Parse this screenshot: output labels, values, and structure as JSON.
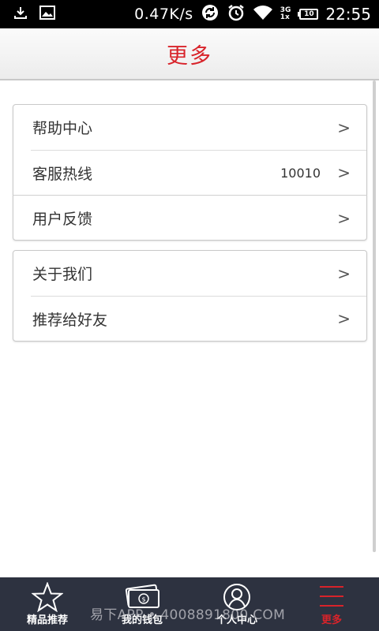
{
  "status_bar": {
    "speed": "0.47K/s",
    "network_top": "3G",
    "network_bottom": "1x",
    "battery": "10",
    "time": "22:55"
  },
  "header": {
    "title": "更多"
  },
  "menu_groups": [
    {
      "items": [
        {
          "label": "帮助中心",
          "value": "",
          "chevron": ">"
        },
        {
          "label": "客服热线",
          "value": "10010",
          "chevron": ">"
        },
        {
          "label": "用户反馈",
          "value": "",
          "chevron": ">"
        }
      ]
    },
    {
      "items": [
        {
          "label": "关于我们",
          "value": "",
          "chevron": ">"
        },
        {
          "label": "推荐给好友",
          "value": "",
          "chevron": ">"
        }
      ]
    }
  ],
  "bottom_nav": {
    "items": [
      {
        "label": "精品推荐",
        "icon": "star-icon",
        "active": false
      },
      {
        "label": "我的钱包",
        "icon": "wallet-icon",
        "active": false
      },
      {
        "label": "个人中心",
        "icon": "user-icon",
        "active": false
      },
      {
        "label": "更多",
        "icon": "menu-icon",
        "active": true
      }
    ]
  },
  "watermark": "易下APP • 4008891800.COM",
  "colors": {
    "accent": "#d8232a",
    "nav_bg": "#2d3240"
  }
}
